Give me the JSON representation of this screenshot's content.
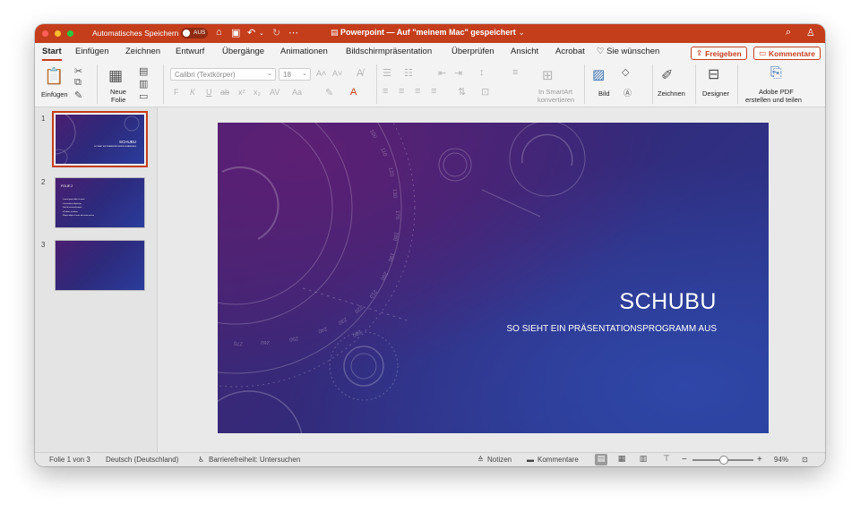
{
  "titlebar": {
    "autosave_label": "Automatisches Speichern",
    "autosave_state": "AUS",
    "doc_name": "Powerpoint",
    "doc_location": "— Auf \"meinem Mac\" gespeichert",
    "traffic_colors": [
      "#ff5f57",
      "#febc2e",
      "#28c840"
    ]
  },
  "tabs": [
    "Start",
    "Einfügen",
    "Zeichnen",
    "Entwurf",
    "Übergänge",
    "Animationen",
    "Bildschirmpräsentation",
    "Überprüfen",
    "Ansicht",
    "Acrobat"
  ],
  "tell_me": "Sie wünschen",
  "share_label": "Freigeben",
  "comments_label": "Kommentare",
  "ribbon": {
    "paste_label": "Einfügen",
    "new_slide_label_1": "Neue",
    "new_slide_label_2": "Folie",
    "font_name": "Calibri (Textkörper)",
    "font_size": "18",
    "smartart_1": "In SmartArt",
    "smartart_2": "konvertieren",
    "picture_label": "Bild",
    "draw_label": "Zeichnen",
    "designer_label": "Designer",
    "adobe_1": "Adobe PDF",
    "adobe_2": "erstellen und teilen"
  },
  "thumbnails": [
    {
      "number": "1",
      "title": "SCHUBU",
      "subtitle": "SO SIEHT EIN PRÄSENTATIONSPROGRAMM AUS"
    },
    {
      "number": "2",
      "title": "FOLIE 2",
      "bullets": [
        "· Lorem ipsum dolor sit amet",
        "· Consectetur adipiscing",
        "· Sed do eiusmod tempor",
        "· Ut labore et dolore",
        "· Magna aliqua ut enim ad minim veniam"
      ]
    },
    {
      "number": "3"
    }
  ],
  "slide": {
    "title": "SCHUBU",
    "subtitle": "SO SIEHT EIN PRÄSENTATIONSPROGRAMM AUS",
    "dial_numbers": [
      "100",
      "110",
      "120",
      "130",
      "170",
      "180",
      "190",
      "200",
      "210",
      "220",
      "230",
      "240",
      "250",
      "260",
      "270",
      "280"
    ]
  },
  "status": {
    "slide_count": "Folie 1 von 3",
    "language": "Deutsch (Deutschland)",
    "accessibility": "Barrierefreiheit: Untersuchen",
    "notes": "Notizen",
    "comments": "Kommentare",
    "zoom": "94%"
  },
  "colors": {
    "accent": "#c43e1c"
  }
}
